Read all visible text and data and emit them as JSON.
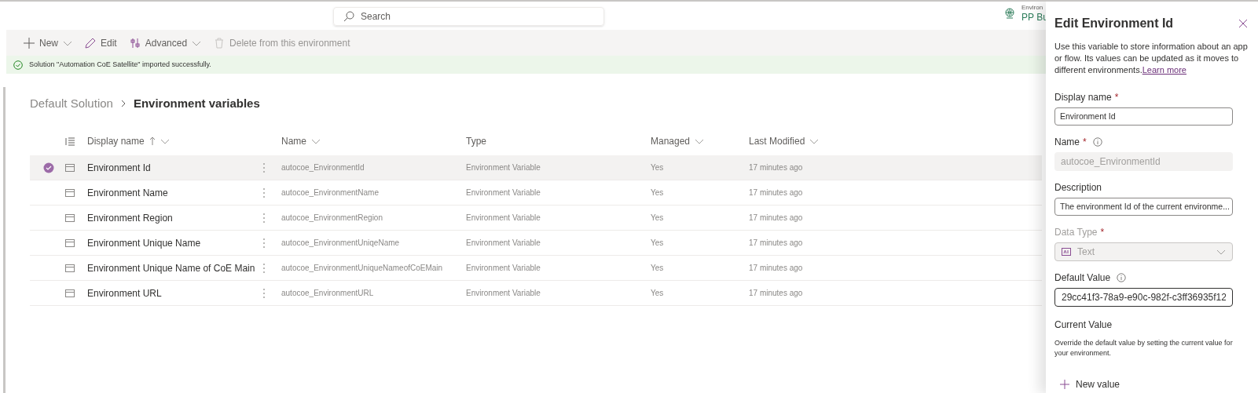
{
  "topbar": {
    "search": {
      "placeholder": "Search"
    },
    "environment": {
      "label": "Environ",
      "name": "PP Bu"
    }
  },
  "commands": [
    {
      "kind": "new",
      "label": "New",
      "menu": true,
      "disabled": false
    },
    {
      "kind": "edit",
      "label": "Edit",
      "menu": false,
      "disabled": false
    },
    {
      "kind": "advanced",
      "label": "Advanced",
      "menu": true,
      "disabled": false
    },
    {
      "kind": "delete",
      "label": "Delete from this environment",
      "menu": false,
      "disabled": true
    }
  ],
  "banner": {
    "message": "Solution \"Automation CoE Satellite\" imported successfully."
  },
  "breadcrumb": [
    {
      "label": "Default Solution",
      "current": false
    },
    {
      "label": "Environment variables",
      "current": true
    }
  ],
  "table": {
    "columns": [
      {
        "label": "Display name",
        "sorted": true,
        "menu": true
      },
      {
        "label": "Name",
        "sorted": false,
        "menu": true
      },
      {
        "label": "Type",
        "sorted": false,
        "menu": false
      },
      {
        "label": "Managed",
        "sorted": false,
        "menu": true
      },
      {
        "label": "Last Modified",
        "sorted": false,
        "menu": true
      }
    ],
    "rows": [
      {
        "display_name": "Environment Id",
        "name": "autocoe_EnvironmentId",
        "type": "Environment Variable",
        "managed": "Yes",
        "last_modified": "17 minutes ago",
        "selected": true
      },
      {
        "display_name": "Environment Name",
        "name": "autocoe_EnvironmentName",
        "type": "Environment Variable",
        "managed": "Yes",
        "last_modified": "17 minutes ago",
        "selected": false
      },
      {
        "display_name": "Environment Region",
        "name": "autocoe_EnvironmentRegion",
        "type": "Environment Variable",
        "managed": "Yes",
        "last_modified": "17 minutes ago",
        "selected": false
      },
      {
        "display_name": "Environment Unique Name",
        "name": "autocoe_EnvironmentUniqeName",
        "type": "Environment Variable",
        "managed": "Yes",
        "last_modified": "17 minutes ago",
        "selected": false
      },
      {
        "display_name": "Environment Unique Name of CoE Main",
        "name": "autocoe_EnvironmentUniqueNameofCoEMain",
        "type": "Environment Variable",
        "managed": "Yes",
        "last_modified": "17 minutes ago",
        "selected": false
      },
      {
        "display_name": "Environment URL",
        "name": "autocoe_EnvironmentURL",
        "type": "Environment Variable",
        "managed": "Yes",
        "last_modified": "17 minutes ago",
        "selected": false
      }
    ]
  },
  "panel": {
    "title": "Edit Environment Id",
    "intro": "Use this variable to store information about an app or flow. Its values can be updated as it moves to different environments.",
    "link": "Learn more",
    "fields": [
      {
        "kind": "input",
        "label": "Display name",
        "required_mark": "*",
        "info": false,
        "value": "Environment Id"
      },
      {
        "kind": "readonly",
        "label": "Name",
        "required_mark": "*",
        "info": true,
        "value": "autocoe_EnvironmentId"
      },
      {
        "kind": "input",
        "label": "Description",
        "info": false,
        "value": "The environment Id of the current environme..."
      },
      {
        "kind": "select",
        "label": "Data Type",
        "required_mark": "*",
        "info": false,
        "value": "Text",
        "disabled": true
      },
      {
        "kind": "input-focused",
        "label": "Default Value",
        "info": true,
        "value": "29cc41f3-78a9-e90c-982f-c3ff36935f12"
      }
    ],
    "current_value": {
      "heading": "Current Value",
      "help": "Override the default value by setting the current value for your environment.",
      "button": "New value"
    }
  }
}
